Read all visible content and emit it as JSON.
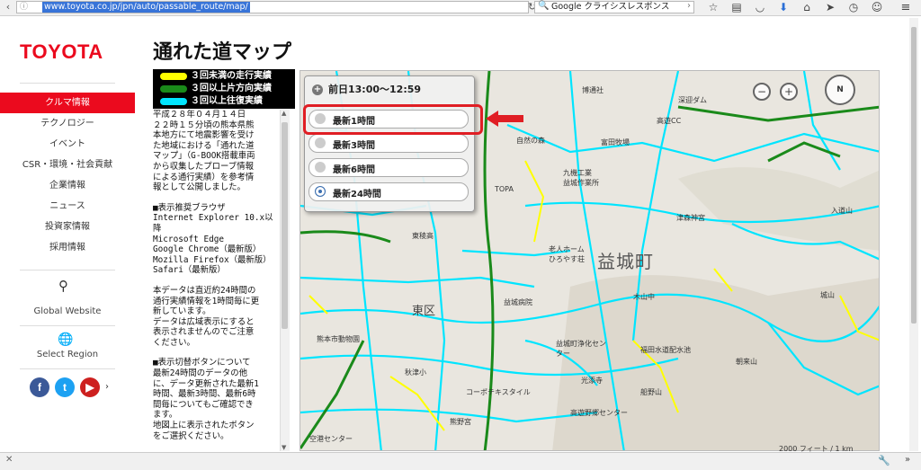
{
  "browser": {
    "url": "www.toyota.co.jp/jpn/auto/passable_route/map/",
    "search_engine": "Google",
    "search_text": "クライシスレスポンス",
    "toolbar_icons": [
      "star-icon",
      "reading-list-icon",
      "pocket-icon",
      "download-icon",
      "home-icon",
      "send-icon",
      "history-icon",
      "smiley-icon"
    ],
    "menu_icon": "hamburger-icon"
  },
  "brand": {
    "logo": "TOYOTA",
    "color": "#eb0a1e"
  },
  "sidebar": {
    "items": [
      {
        "label": "クルマ情報",
        "active": true
      },
      {
        "label": "テクノロジー"
      },
      {
        "label": "イベント"
      },
      {
        "label": "CSR・環境・社会貢献"
      },
      {
        "label": "企業情報"
      },
      {
        "label": "ニュース"
      },
      {
        "label": "投資家情報"
      },
      {
        "label": "採用情報"
      }
    ],
    "search_icon": "search-icon",
    "global_website": "Global Website",
    "globe_icon": "globe-icon",
    "select_region": "Select Region",
    "social": {
      "facebook": "f",
      "twitter": "t",
      "youtube": "▶",
      "more": "›"
    }
  },
  "page": {
    "title": "通れた道マップ"
  },
  "legend": {
    "items": [
      {
        "label": "３回未満の走行実績",
        "color": "#ffff00"
      },
      {
        "label": "３回以上片方向実績",
        "color": "#1a8a1a"
      },
      {
        "label": "３回以上往復実績",
        "color": "#00e5ff"
      }
    ]
  },
  "info": {
    "paragraphs": [
      "平成２８年０４月１４日\n２２時１５分頃の熊本県熊\n本地方にて地震影響を受け\nた地域における「通れた道\nマップ」（G-BOOK搭載車両\nから収集したプローブ情報\nによる通行実績）を参考情\n報として公開しました。",
      "■表示推奨ブラウザ\nInternet Explorer 10.x以\n降\nMicrosoft Edge\nGoogle Chrome（最新版）\nMozilla Firefox（最新版）\nSafari（最新版）",
      "本データは直近約24時間の\n通行実績情報を1時間毎に更\n新しています。\nデータは広域表示にすると\n表示されませんのでご注意\nください。",
      "■表示切替ボタンについて\n最新24時間のデータの他\nに、データ更新された最新1\n時間、最新3時間、最新6時\n間毎についてもご確認でき\nます。\n地図上に表示されたボタン\nをご選択ください。"
    ]
  },
  "map": {
    "time_range": "前日13:00〜12:59",
    "options": [
      {
        "label": "最新1時間",
        "selected": false
      },
      {
        "label": "最新3時間",
        "selected": false
      },
      {
        "label": "最新6時間",
        "selected": false
      },
      {
        "label": "最新24時間",
        "selected": true
      }
    ],
    "place_labels": {
      "mashiki": "益城町",
      "higashi_ku": "東区",
      "hakata": "博通社",
      "fukada_dam": "深迎ダム",
      "takayu": "高遊CC",
      "tomita": "富田牧場",
      "kyushu": "九機工業",
      "mashiki_works": "益城作業所",
      "shizen": "自然の森",
      "takada_hwy": "TOPA",
      "tsumori": "津森神宮",
      "rojin": "老人ホーム",
      "hirayasu": "ひろやす荘",
      "kouhaku": "東稜高",
      "mashiki_hosp": "益城病院",
      "kiyama": "木山中",
      "kumamoto_zoo": "熊本市動物園",
      "mashiki_center": "益城町浄化センター",
      "fukuda": "福田水道配水池",
      "asahi": "朝来山",
      "funano": "船野山",
      "kumaeki": "熊野宮",
      "akitsu": "秋津小",
      "copotex": "コーポテキスタイル",
      "kojima": "城山",
      "nigayu": "入道山",
      "airport_center": "空港センター",
      "koyama": "光添寺",
      "jikou": "高遊野郷センター"
    },
    "scale": "2000 フィート / 1 km",
    "compass": "N"
  },
  "colors": {
    "yellow": "#ffff00",
    "green": "#1a8a1a",
    "cyan": "#00e5ff",
    "highlight": "#e01e24"
  }
}
